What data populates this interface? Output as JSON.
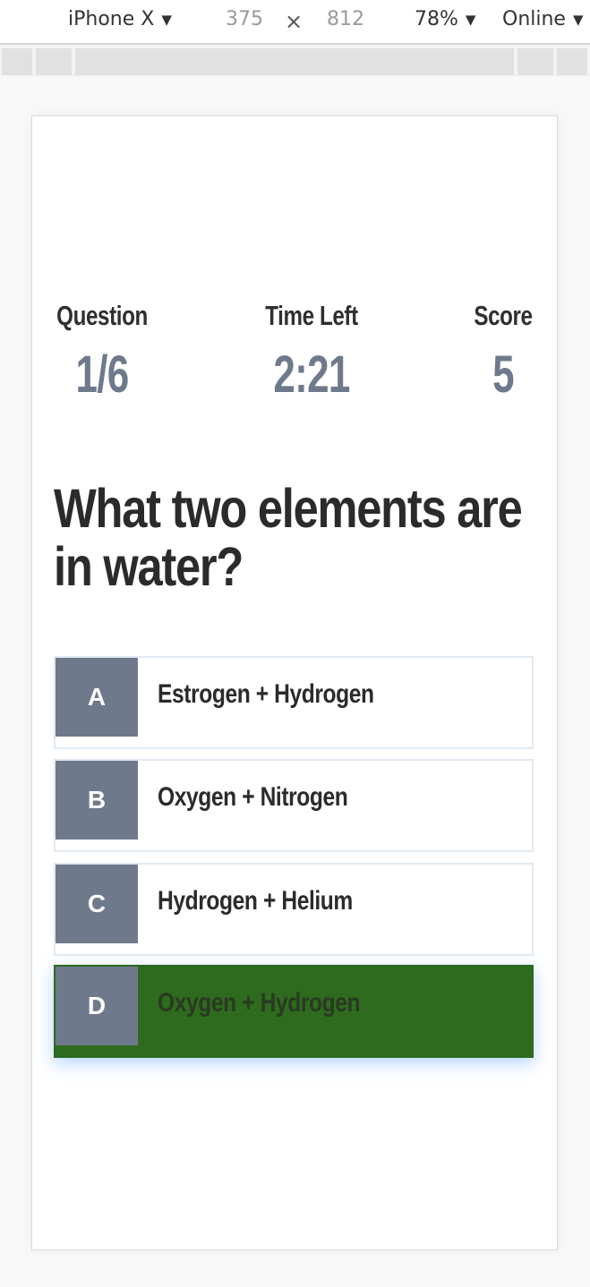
{
  "devtools": {
    "device": "iPhone X",
    "width": "375",
    "times": "×",
    "height": "812",
    "zoom": "78%",
    "network": "Online"
  },
  "hud": {
    "question_label": "Question",
    "question_value": "1/6",
    "time_label": "Time Left",
    "time_value": "2:21",
    "score_label": "Score",
    "score_value": "5"
  },
  "question": {
    "line1": "What two elements are",
    "line2": "in water?"
  },
  "choices": [
    {
      "prefix": "A",
      "text": "Estrogen + Hydrogen",
      "state": "default"
    },
    {
      "prefix": "B",
      "text": "Oxygen + Nitrogen",
      "state": "default"
    },
    {
      "prefix": "C",
      "text": "Hydrogen + Helium",
      "state": "default"
    },
    {
      "prefix": "D",
      "text": "Oxygen + Hydrogen",
      "state": "correct"
    }
  ],
  "colors": {
    "accent": "#6e7a8c",
    "correct": "#2e6b1e",
    "text": "#2b2b2b"
  }
}
